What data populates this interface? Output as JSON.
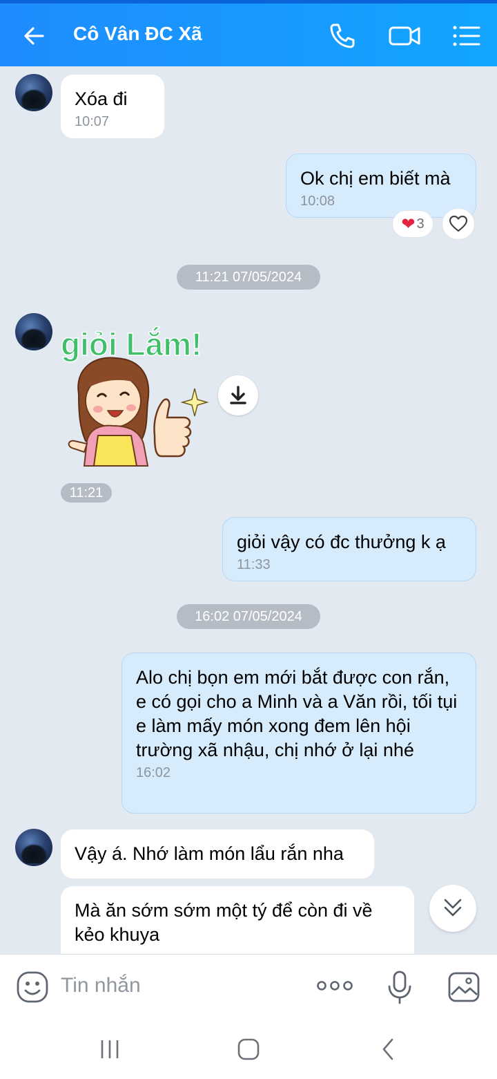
{
  "header": {
    "title": "Cô Vân ĐC Xã",
    "back_icon": "arrow-left-icon",
    "call_icon": "phone-icon",
    "video_icon": "video-camera-icon",
    "menu_icon": "list-menu-icon",
    "color": "#1f8cff"
  },
  "messages": [
    {
      "dir": "in",
      "text": "Xóa đi",
      "time": "10:07"
    },
    {
      "dir": "out",
      "text": "Ok chị em biết mà",
      "time": "10:08",
      "reaction_count": "3"
    },
    {
      "dir": "in",
      "type": "sticker",
      "sticker_text": "giỏi Lắm!",
      "time": "11:21"
    },
    {
      "dir": "out",
      "text": "giỏi vậy có đc thưởng k ạ",
      "time": "11:33"
    },
    {
      "dir": "out",
      "text": "Alo chị bọn em mới bắt được con rắn, e có gọi cho a Minh và a Văn rồi, tối tụi e làm mấy món xong đem lên hội trường xã nhậu, chị nhớ ở lại nhé",
      "time": "16:02"
    },
    {
      "dir": "in",
      "text": "Vậy á. Nhớ làm món lẩu rắn nha"
    },
    {
      "dir": "in",
      "text": "Mà ăn sớm sớm một tý để còn đi về kẻo khuya"
    }
  ],
  "date_separators": [
    "11:21 07/05/2024",
    "16:02 07/05/2024"
  ],
  "input": {
    "placeholder": "Tin nhắn",
    "emoji_icon": "emoji-icon",
    "more_icon": "more-dots-icon",
    "mic_icon": "microphone-icon",
    "image_icon": "image-icon"
  },
  "navbar": {
    "recents_icon": "recents-icon",
    "home_icon": "home-icon",
    "back_icon": "back-chevron-icon"
  }
}
